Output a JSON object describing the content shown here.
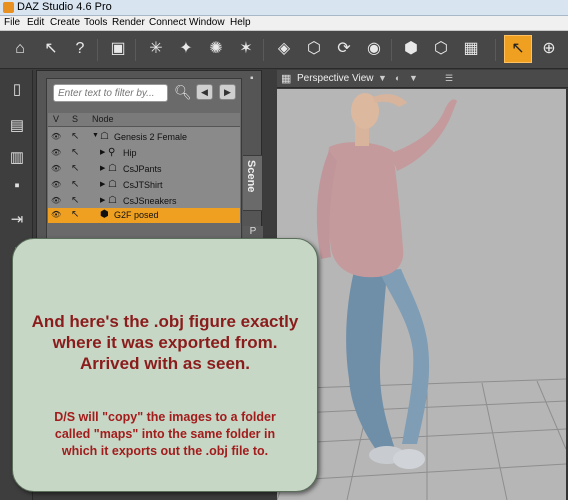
{
  "window": {
    "title": "DAZ Studio 4.6 Pro"
  },
  "menu": [
    "File",
    "Edit",
    "Create",
    "Tools",
    "Render",
    "Connect",
    "Window",
    "Help"
  ],
  "toolbar": {
    "icons": [
      "home-icon",
      "pointer-help-icon",
      "help-icon",
      "camera-icon",
      "light-wand-icon",
      "spot-light-icon",
      "light-bulb-icon",
      "light-rays-icon",
      "primitive-cube-icon",
      "rotate-icon",
      "node-icon",
      "cube-outline-icon",
      "cube-select-icon",
      "cube-cursor-icon",
      "select-tool-icon",
      "universal-tool-icon"
    ]
  },
  "scene": {
    "filter_placeholder": "Enter text to filter by...",
    "tab_label": "Scene",
    "tab2_label": "P",
    "columns": {
      "v": "V",
      "s": "S",
      "node": "Node"
    },
    "nodes": [
      {
        "label": "Genesis 2 Female",
        "arrow": "▼"
      },
      {
        "label": "Hip",
        "arrow": "▶"
      },
      {
        "label": "CsJPants",
        "arrow": "▶"
      },
      {
        "label": "CsJTShirt",
        "arrow": "▶"
      },
      {
        "label": "CsJSneakers",
        "arrow": "▶"
      },
      {
        "label": "G2F posed",
        "arrow": ""
      }
    ]
  },
  "viewport": {
    "title": "Perspective View"
  },
  "callout": {
    "main_line1": "And here's the .obj figure exactly",
    "main_line2": "where it was exported from.",
    "main_line3": "Arrived with as seen.",
    "sub_line1": "D/S will \"copy\" the images to a folder",
    "sub_line2": "called \"maps\" into the same folder in",
    "sub_line3": "which it exports out the .obj file to."
  },
  "colors": {
    "accent": "#f0a020",
    "callout_bg": "#c7d7c6",
    "callout_text": "#8a1c1c"
  }
}
